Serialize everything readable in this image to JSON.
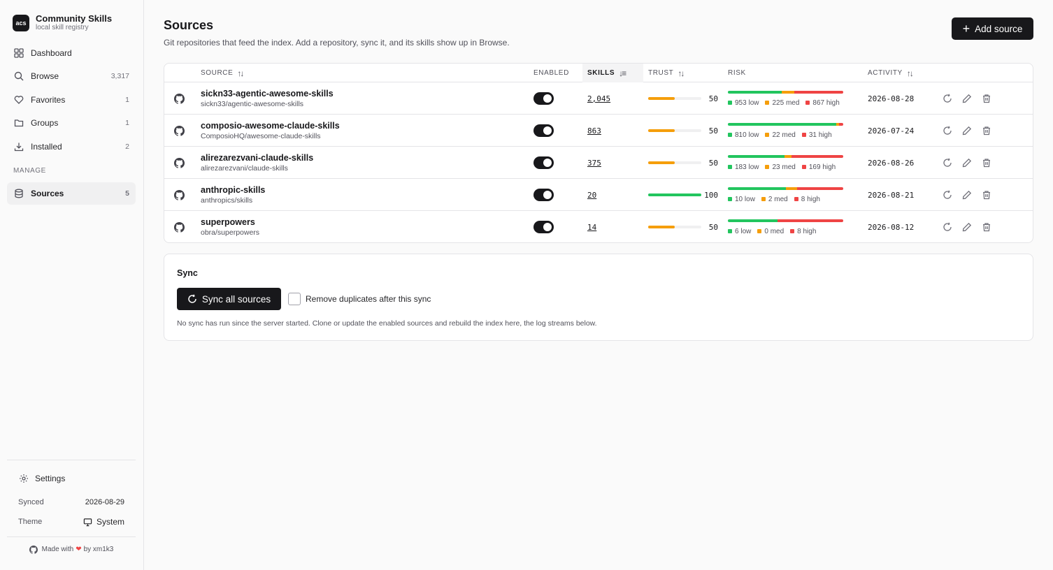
{
  "brand": {
    "logo": "acs",
    "name": "Community Skills",
    "subtitle": "local skill registry"
  },
  "nav": [
    {
      "label": "Dashboard",
      "icon": "grid-icon",
      "count": ""
    },
    {
      "label": "Browse",
      "icon": "search-icon",
      "count": "3,317"
    },
    {
      "label": "Favorites",
      "icon": "heart-icon",
      "count": "1"
    },
    {
      "label": "Groups",
      "icon": "folder-icon",
      "count": "1"
    },
    {
      "label": "Installed",
      "icon": "download-icon",
      "count": "2"
    }
  ],
  "manage_label": "MANAGE",
  "manage_nav": [
    {
      "label": "Sources",
      "icon": "database-icon",
      "count": "5",
      "active": true
    }
  ],
  "footer": {
    "settings_label": "Settings",
    "synced_label": "Synced",
    "synced_value": "2026-08-29",
    "theme_label": "Theme",
    "theme_value": "System",
    "made_prefix": "Made with",
    "made_suffix": "by xm1k3"
  },
  "page": {
    "title": "Sources",
    "description": "Git repositories that feed the index. Add a repository, sync it, and its skills show up in Browse.",
    "add_button": "Add source"
  },
  "table": {
    "headers": {
      "source": "SOURCE",
      "enabled": "ENABLED",
      "skills": "SKILLS",
      "trust": "TRUST",
      "risk": "RISK",
      "activity": "ACTIVITY"
    },
    "rows": [
      {
        "name": "sickn33-agentic-awesome-skills",
        "repo": "sickn33/agentic-awesome-skills",
        "enabled": true,
        "skills": "2,045",
        "trust": 50,
        "low": 953,
        "med": 225,
        "high": 867,
        "activity": "2026-08-28"
      },
      {
        "name": "composio-awesome-claude-skills",
        "repo": "ComposioHQ/awesome-claude-skills",
        "enabled": true,
        "skills": "863",
        "trust": 50,
        "low": 810,
        "med": 22,
        "high": 31,
        "activity": "2026-07-24"
      },
      {
        "name": "alirezarezvani-claude-skills",
        "repo": "alirezarezvani/claude-skills",
        "enabled": true,
        "skills": "375",
        "trust": 50,
        "low": 183,
        "med": 23,
        "high": 169,
        "activity": "2026-08-26"
      },
      {
        "name": "anthropic-skills",
        "repo": "anthropics/skills",
        "enabled": true,
        "skills": "20",
        "trust": 100,
        "low": 10,
        "med": 2,
        "high": 8,
        "activity": "2026-08-21"
      },
      {
        "name": "superpowers",
        "repo": "obra/superpowers",
        "enabled": true,
        "skills": "14",
        "trust": 50,
        "low": 6,
        "med": 0,
        "high": 8,
        "activity": "2026-08-12"
      }
    ],
    "risk_suffix": {
      "low": "low",
      "med": "med",
      "high": "high"
    }
  },
  "sync": {
    "title": "Sync",
    "button": "Sync all sources",
    "checkbox_label": "Remove duplicates after this sync",
    "note": "No sync has run since the server started. Clone or update the enabled sources and rebuild the index here, the log streams below."
  },
  "colors": {
    "low": "#22c55e",
    "med": "#f59e0b",
    "high": "#ef4444",
    "trust_mid": "#f59e0b",
    "trust_high": "#22c55e"
  }
}
